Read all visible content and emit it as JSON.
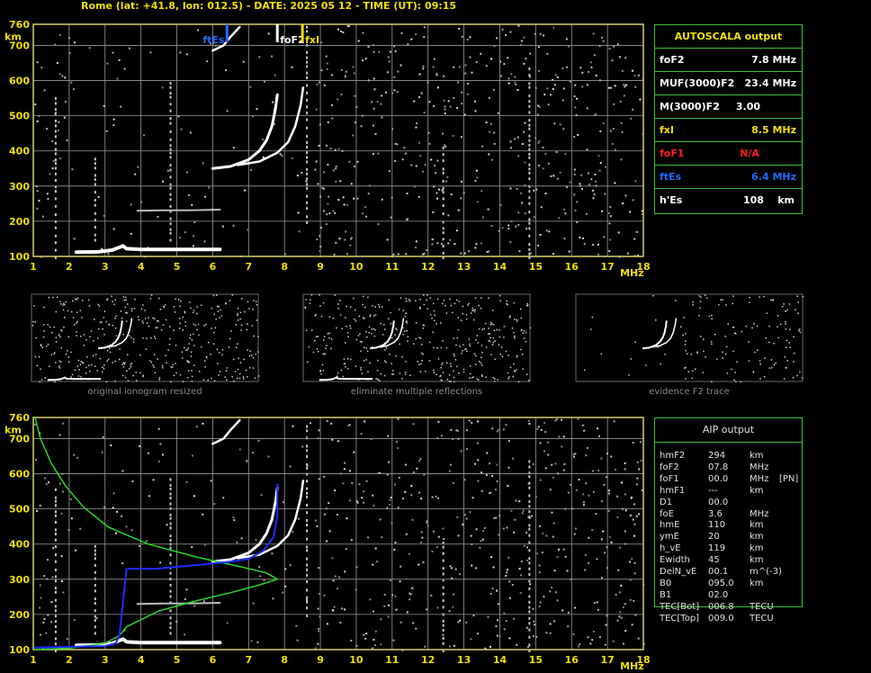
{
  "header": "Rome (lat: +41.8, lon: 012.5) - DATE: 2025 05 12 - TIME (UT): 09:15",
  "colors": {
    "grid": "#9a9a9a",
    "frame": "#d8d070",
    "fof2": "#ffffff",
    "fxi": "#f0e000",
    "fof1": "#ff2020",
    "ftes": "#1e6cff",
    "profile": "#2ad62a",
    "inverted_trace": "#1c2cff",
    "table_border": "#3ac13a"
  },
  "chart_data": [
    {
      "type": "scatter",
      "name": "ionogram",
      "xlabel": "MHz",
      "ylabel": "km",
      "xlim": [
        1,
        18
      ],
      "ylim": [
        100,
        760
      ],
      "x_ticks": [
        "1",
        "2",
        "3",
        "4",
        "5",
        "6",
        "7",
        "8",
        "9",
        "10",
        "11",
        "12",
        "13",
        "14",
        "15",
        "16",
        "17",
        "18"
      ],
      "y_ticks": [
        "760",
        "700",
        "600",
        "500",
        "400",
        "300",
        "200",
        "100"
      ],
      "grid": true,
      "markers": [
        {
          "label": "ftEs",
          "x": 6.4,
          "color": "#1e6cff"
        },
        {
          "label": "foF2",
          "x": 7.8,
          "color": "#ffffff"
        },
        {
          "label": "fxI",
          "x": 8.5,
          "color": "#f0e000"
        }
      ],
      "o_trace": [
        [
          6.0,
          350
        ],
        [
          6.5,
          356
        ],
        [
          7.0,
          375
        ],
        [
          7.3,
          400
        ],
        [
          7.5,
          430
        ],
        [
          7.65,
          470
        ],
        [
          7.75,
          520
        ],
        [
          7.8,
          560
        ]
      ],
      "x_trace": [
        [
          6.7,
          360
        ],
        [
          7.3,
          370
        ],
        [
          7.8,
          395
        ],
        [
          8.1,
          425
        ],
        [
          8.3,
          470
        ],
        [
          8.45,
          530
        ],
        [
          8.52,
          580
        ]
      ],
      "es_trace": [
        [
          2.2,
          112
        ],
        [
          2.8,
          113
        ],
        [
          3.2,
          118
        ],
        [
          3.5,
          130
        ],
        [
          3.6,
          122
        ],
        [
          4.0,
          120
        ],
        [
          5.0,
          120
        ],
        [
          6.2,
          120
        ]
      ],
      "es2_trace": [
        [
          3.9,
          230
        ],
        [
          4.6,
          231
        ],
        [
          5.3,
          231
        ],
        [
          5.8,
          232
        ],
        [
          6.2,
          233
        ]
      ],
      "cusp_trace": [
        [
          6.0,
          685
        ],
        [
          6.3,
          700
        ],
        [
          6.5,
          725
        ],
        [
          6.75,
          752
        ]
      ]
    },
    {
      "type": "line",
      "name": "electron-density-profile",
      "xlabel": "MHz",
      "ylabel": "km",
      "xlim": [
        1,
        18
      ],
      "ylim": [
        100,
        760
      ],
      "grid": true,
      "profile": [
        [
          1.05,
          100
        ],
        [
          2.0,
          104
        ],
        [
          3.0,
          118
        ],
        [
          3.4,
          140
        ],
        [
          3.6,
          165
        ],
        [
          4.5,
          210
        ],
        [
          5.5,
          238
        ],
        [
          6.5,
          262
        ],
        [
          7.3,
          284
        ],
        [
          7.8,
          300
        ],
        [
          7.5,
          318
        ],
        [
          6.8,
          335
        ],
        [
          5.6,
          362
        ],
        [
          4.2,
          400
        ],
        [
          3.1,
          448
        ],
        [
          2.4,
          505
        ],
        [
          1.9,
          565
        ],
        [
          1.5,
          630
        ],
        [
          1.2,
          700
        ],
        [
          1.05,
          760
        ]
      ],
      "inverted_trace": [
        [
          1.05,
          106
        ],
        [
          2.0,
          108
        ],
        [
          3.0,
          110
        ],
        [
          3.3,
          118
        ],
        [
          3.4,
          140
        ],
        [
          3.6,
          330
        ],
        [
          4.4,
          330
        ],
        [
          5.5,
          340
        ],
        [
          6.5,
          350
        ],
        [
          7.0,
          358
        ],
        [
          7.4,
          380
        ],
        [
          7.7,
          420
        ],
        [
          7.8,
          480
        ],
        [
          7.8,
          570
        ]
      ]
    }
  ],
  "thumbnails": [
    {
      "caption": "original ionogram resized"
    },
    {
      "caption": "eliminate multiple reflections"
    },
    {
      "caption": "evidence F2 trace"
    }
  ],
  "autoscala": {
    "title": "AUTOSCALA output",
    "rows": [
      {
        "key": "foF2",
        "value": "7.8 MHz",
        "color": "#ffffff"
      },
      {
        "key": "MUF(3000)F2",
        "value": "23.4 MHz",
        "color": "#ffffff"
      },
      {
        "key": "M(3000)F2",
        "value": "3.00",
        "color": "#ffffff"
      },
      {
        "key": "fxI",
        "value": "8.5 MHz",
        "color": "#f0e000"
      },
      {
        "key": "foF1",
        "value": "N/A",
        "color": "#ff2020"
      },
      {
        "key": "ftEs",
        "value": "6.4 MHz",
        "color": "#1e6cff"
      },
      {
        "key": "h'Es",
        "value": "108    km",
        "color": "#ffffff"
      }
    ]
  },
  "aip": {
    "title": "AIP output",
    "rows": [
      {
        "key": "hmF2",
        "value": "294",
        "unit": "km",
        "extra": ""
      },
      {
        "key": "foF2",
        "value": "07.8",
        "unit": "MHz",
        "extra": ""
      },
      {
        "key": "foF1",
        "value": "00.0",
        "unit": "MHz",
        "extra": "[PN]"
      },
      {
        "key": "hmF1",
        "value": "---",
        "unit": "km",
        "extra": ""
      },
      {
        "key": "D1",
        "value": "00.0",
        "unit": "",
        "extra": ""
      },
      {
        "key": "foE",
        "value": "3.6",
        "unit": "MHz",
        "extra": ""
      },
      {
        "key": "hmE",
        "value": "110",
        "unit": "km",
        "extra": ""
      },
      {
        "key": "ymE",
        "value": "20",
        "unit": "km",
        "extra": ""
      },
      {
        "key": "h_vE",
        "value": "119",
        "unit": "km",
        "extra": ""
      },
      {
        "key": "Ewidth",
        "value": "45",
        "unit": "km",
        "extra": ""
      },
      {
        "key": "DelN_vE",
        "value": "00.1",
        "unit": "m^(-3)",
        "extra": ""
      },
      {
        "key": "B0",
        "value": "095.0",
        "unit": "km",
        "extra": ""
      },
      {
        "key": "B1",
        "value": "02.0",
        "unit": "",
        "extra": ""
      },
      {
        "key": "TEC[Bot]",
        "value": "006.8",
        "unit": "TECU",
        "extra": ""
      },
      {
        "key": "TEC[Top]",
        "value": "009.0",
        "unit": "TECU",
        "extra": ""
      }
    ]
  }
}
